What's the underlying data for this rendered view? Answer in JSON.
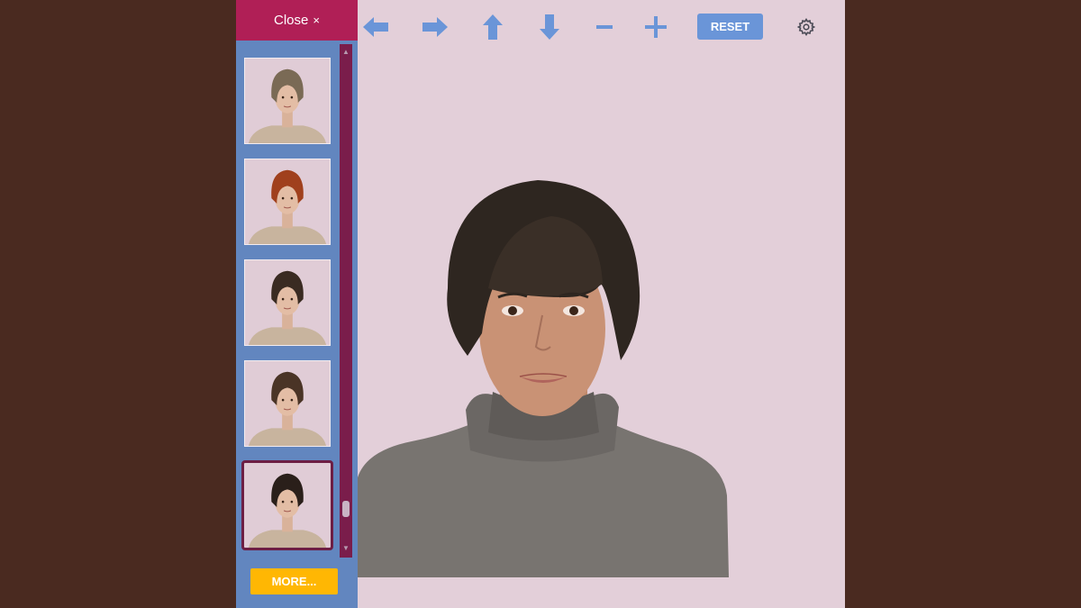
{
  "sidebar": {
    "close_label": "Close",
    "close_symbol": "×",
    "more_label": "MORE...",
    "styles": [
      {
        "name": "bob-light-brown",
        "hair_color": "#7a6a55",
        "selected": false
      },
      {
        "name": "bob-auburn",
        "hair_color": "#a0401d",
        "selected": false
      },
      {
        "name": "curly-dark",
        "hair_color": "#3a2b22",
        "selected": false
      },
      {
        "name": "pixie-brown",
        "hair_color": "#4a3426",
        "selected": false
      },
      {
        "name": "bowl-black",
        "hair_color": "#2a1f1a",
        "selected": true
      }
    ]
  },
  "toolbar": {
    "icons": [
      "arrow-left-icon",
      "arrow-right-icon",
      "arrow-up-icon",
      "arrow-down-icon",
      "minus-icon",
      "plus-icon"
    ],
    "reset_label": "RESET",
    "settings_icon": "gear-icon"
  },
  "colors": {
    "accent": "#b01f56",
    "sidebar": "#6286bf",
    "canvas": "#e3cfd9",
    "button_blue": "#6a95d8",
    "more_button": "#ffb703",
    "page_bg": "#4a2a20"
  }
}
